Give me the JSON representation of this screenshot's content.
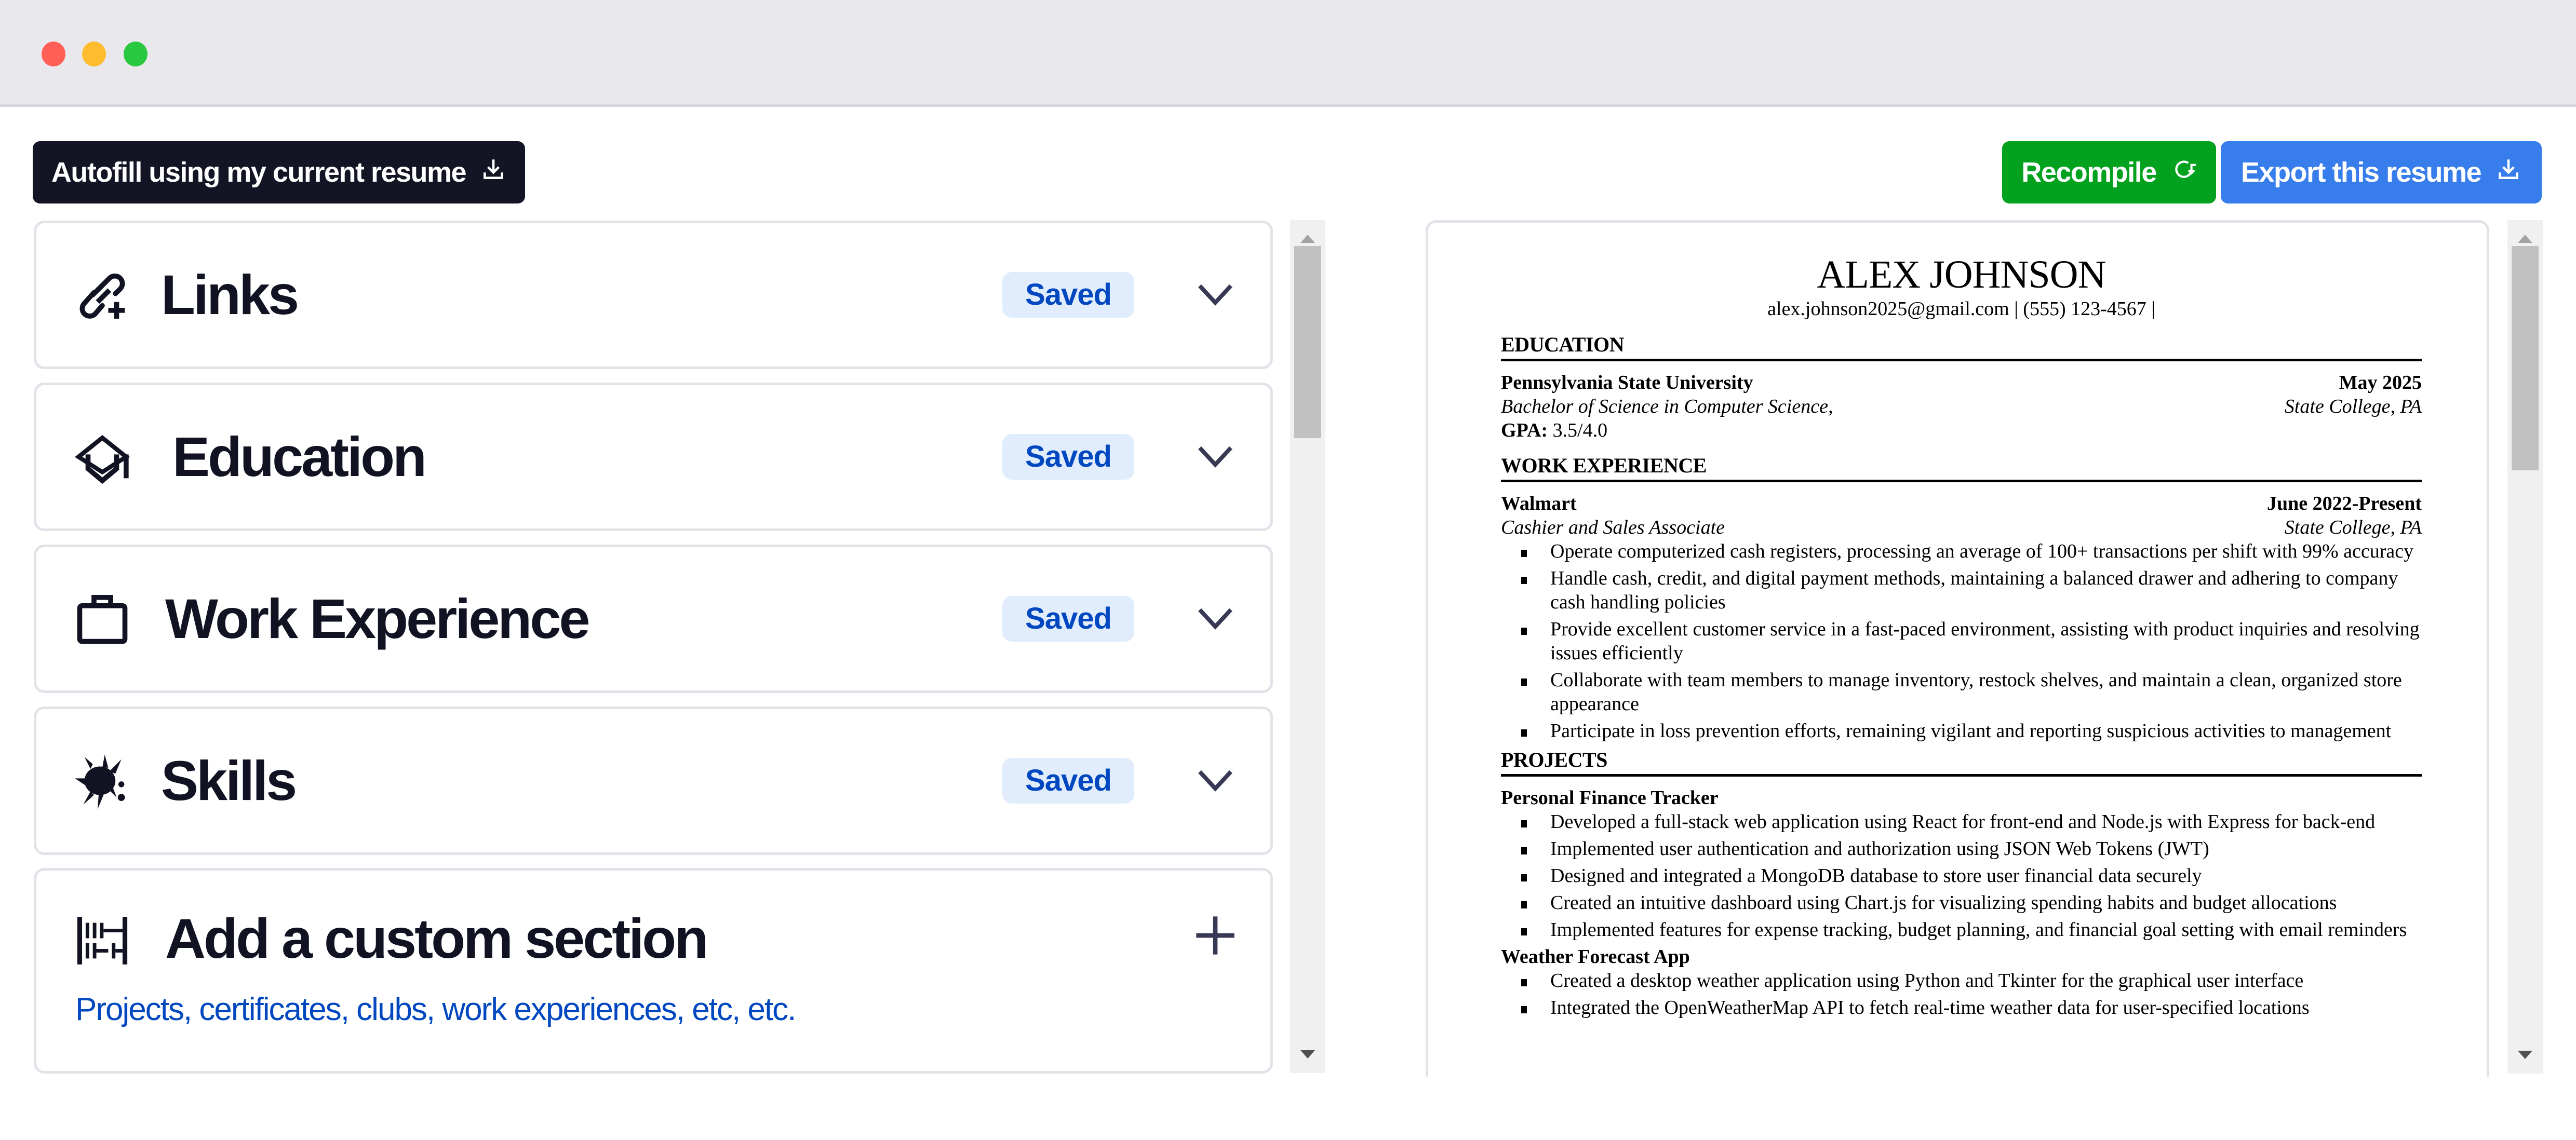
{
  "window": {
    "controls": [
      "close",
      "minimize",
      "maximize"
    ]
  },
  "toolbar": {
    "autofill_label": "Autofill using my current resume",
    "recompile_label": "Recompile",
    "export_label": "Export this resume"
  },
  "colors": {
    "autofill_bg": "#131524",
    "recompile_bg": "#02A21F",
    "export_bg": "#377DEB",
    "badge_bg": "#E1EDFC",
    "badge_text": "#0047C0"
  },
  "sections": [
    {
      "title": "Links",
      "icon": "link-plus-icon",
      "status": "Saved"
    },
    {
      "title": "Education",
      "icon": "graduation-cap-icon",
      "status": "Saved"
    },
    {
      "title": "Work Experience",
      "icon": "briefcase-icon",
      "status": "Saved"
    },
    {
      "title": "Skills",
      "icon": "splash-icon",
      "status": "Saved"
    }
  ],
  "custom_section": {
    "title": "Add a custom section",
    "subtitle": "Projects, certificates, clubs, work experiences, etc, etc.",
    "icon": "abacus-icon"
  },
  "left_scroll": {
    "position_fraction": 0.0,
    "visible_fraction": 0.24
  },
  "right_scroll": {
    "position_fraction": 0.0,
    "visible_fraction": 0.28
  },
  "resume": {
    "name": "ALEX JOHNSON",
    "contact": "alex.johnson2025@gmail.com | (555) 123-4567 |",
    "education": {
      "heading": "EDUCATION",
      "school": "Pennsylvania State University",
      "date": "May 2025",
      "degree": "Bachelor of Science in Computer Science,",
      "location": "State College, PA",
      "gpa_label": "GPA:",
      "gpa_value": " 3.5/4.0"
    },
    "work": {
      "heading": "WORK EXPERIENCE",
      "company": "Walmart",
      "date": "June 2022-Present",
      "role": "Cashier and Sales Associate",
      "location": "State College, PA",
      "bullets": [
        "Operate computerized cash registers, processing an average of 100+ transactions per shift with 99% accuracy",
        "Handle cash, credit, and digital payment methods, maintaining a balanced drawer and adhering to company cash handling policies",
        "Provide excellent customer service in a fast-paced environment, assisting with product inquiries and resolving issues efficiently",
        "Collaborate with team members to manage inventory, restock shelves, and maintain a clean, organized store appearance",
        "Participate in loss prevention efforts, remaining vigilant and reporting suspicious activities to management"
      ]
    },
    "projects": {
      "heading": "PROJECTS",
      "items": [
        {
          "name": "Personal Finance Tracker",
          "bullets": [
            "Developed a full-stack web application using React for front-end and Node.js with Express for back-end",
            "Implemented user authentication and authorization using JSON Web Tokens (JWT)",
            "Designed and integrated a MongoDB database to store user financial data securely",
            "Created an intuitive dashboard using Chart.js for visualizing spending habits and budget allocations",
            "Implemented features for expense tracking, budget planning, and financial goal setting with email reminders"
          ]
        },
        {
          "name": "Weather Forecast App",
          "bullets": [
            "Created a desktop weather application using Python and Tkinter for the graphical user interface",
            "Integrated the OpenWeatherMap API to fetch real-time weather data for user-specified locations"
          ]
        }
      ]
    }
  }
}
